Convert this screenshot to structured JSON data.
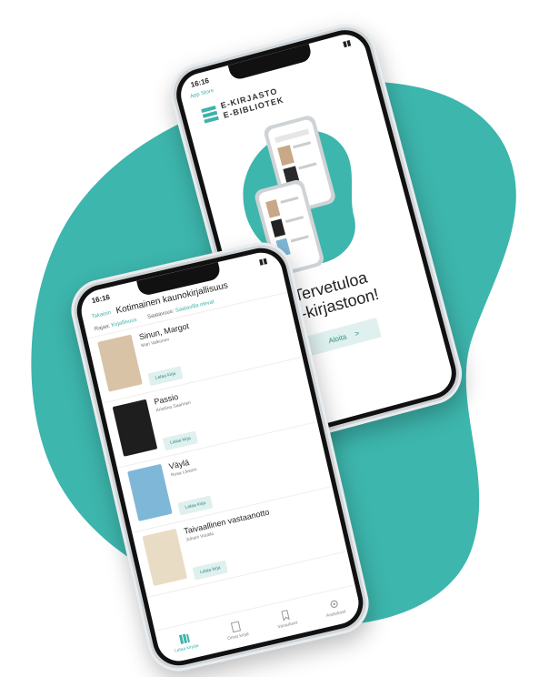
{
  "colors": {
    "accent": "#3fb3aa",
    "blob": "#3db6ad",
    "button_bg": "#dff0ee"
  },
  "list_screen": {
    "time": "16:16",
    "back_label": "Takaisin",
    "title": "Kotimainen kaunokirjallisuus",
    "filter1_label": "Rajaa:",
    "filter1_value": "Kirjallisuus",
    "filter2_label": "Saatavuus:",
    "filter2_value": "Saatavilla olevat",
    "books": [
      {
        "title": "Sinun, Margot",
        "author": "Mari Valkonen",
        "button": "Lataa kirja"
      },
      {
        "title": "Passio",
        "author": "Kristiina Saarinen",
        "button": "Lataa kirja"
      },
      {
        "title": "Väylä",
        "author": "Rosa Liksom",
        "button": "Lataa kirja"
      },
      {
        "title": "Taivaallinen vastaanotto",
        "author": "Juhani Voutila",
        "button": "Lataa kirja"
      }
    ],
    "tabs": [
      {
        "label": "Lataa kirjoja",
        "icon": "library-icon"
      },
      {
        "label": "Omat kirjat",
        "icon": "book-icon"
      },
      {
        "label": "Varaukset",
        "icon": "bookmark-icon"
      },
      {
        "label": "Asetukset",
        "icon": "gear-icon"
      }
    ]
  },
  "welcome_screen": {
    "time": "16:16",
    "app_store_label": "App Store",
    "logo_line1": "E-KIRJASTO",
    "logo_line2": "E-BIBLIOTEK",
    "title_line1": "Tervetuloa",
    "title_line2": "e-kirjastoon!",
    "start_button": "Aloita",
    "start_arrow": ">"
  }
}
